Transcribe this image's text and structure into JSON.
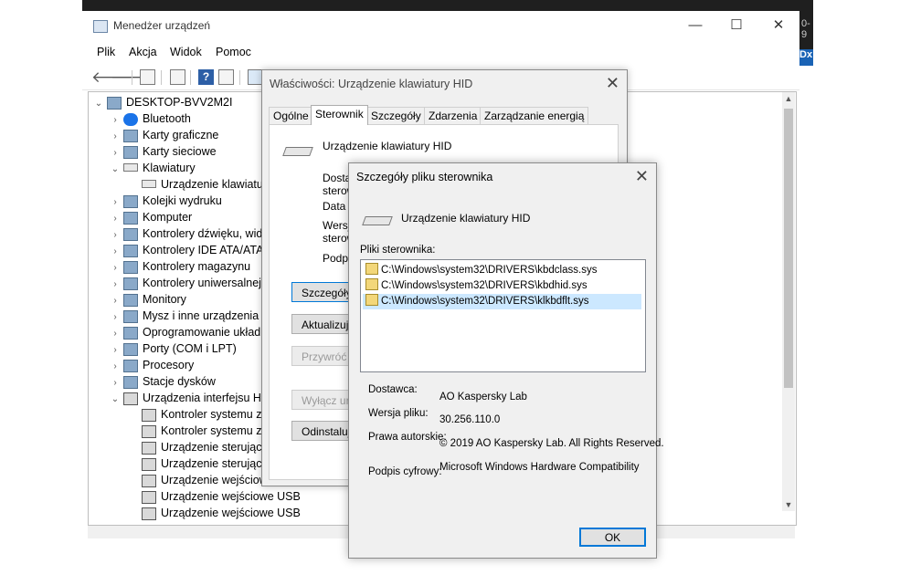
{
  "background_strip": {
    "text_top": "0-9",
    "text_badge": "Dx"
  },
  "device_manager": {
    "title": "Menedżer urządzeń",
    "caption": {
      "minimize": "—",
      "maximize": "☐",
      "close": "✕"
    },
    "menu": [
      "Plik",
      "Akcja",
      "Widok",
      "Pomoc"
    ],
    "tree": [
      {
        "label": "DESKTOP-BVV2M2I",
        "expander": "⌄",
        "icon": "computer-icon",
        "level": 0
      },
      {
        "label": "Bluetooth",
        "expander": "›",
        "icon": "bluetooth-icon",
        "level": 1
      },
      {
        "label": "Karty graficzne",
        "expander": "›",
        "icon": "display-adapter-icon",
        "level": 1
      },
      {
        "label": "Karty sieciowe",
        "expander": "›",
        "icon": "network-adapter-icon",
        "level": 1
      },
      {
        "label": "Klawiatury",
        "expander": "⌄",
        "icon": "keyboard-icon",
        "level": 1
      },
      {
        "label": "Urządzenie klawiatur",
        "expander": "",
        "icon": "keyboard-icon",
        "level": 2
      },
      {
        "label": "Kolejki wydruku",
        "expander": "›",
        "icon": "printer-icon",
        "level": 1
      },
      {
        "label": "Komputer",
        "expander": "›",
        "icon": "monitor-icon",
        "level": 1
      },
      {
        "label": "Kontrolery dźwięku, wid",
        "expander": "›",
        "icon": "speaker-icon",
        "level": 1
      },
      {
        "label": "Kontrolery IDE ATA/ATAP",
        "expander": "›",
        "icon": "ide-controller-icon",
        "level": 1
      },
      {
        "label": "Kontrolery magazynu",
        "expander": "›",
        "icon": "storage-controller-icon",
        "level": 1
      },
      {
        "label": "Kontrolery uniwersalnej",
        "expander": "›",
        "icon": "usb-icon",
        "level": 1
      },
      {
        "label": "Monitory",
        "expander": "›",
        "icon": "monitor-icon",
        "level": 1
      },
      {
        "label": "Mysz i inne urządzenia w",
        "expander": "›",
        "icon": "mouse-icon",
        "level": 1
      },
      {
        "label": "Oprogramowanie układ",
        "expander": "›",
        "icon": "chip-icon",
        "level": 1
      },
      {
        "label": "Porty (COM i LPT)",
        "expander": "›",
        "icon": "port-icon",
        "level": 1
      },
      {
        "label": "Procesory",
        "expander": "›",
        "icon": "processor-icon",
        "level": 1
      },
      {
        "label": "Stacje dysków",
        "expander": "›",
        "icon": "disk-drive-icon",
        "level": 1
      },
      {
        "label": "Urządzenia interfejsu HI",
        "expander": "⌄",
        "icon": "hid-icon",
        "level": 1
      },
      {
        "label": "Kontroler systemu zg",
        "expander": "",
        "icon": "hid-icon",
        "level": 2
      },
      {
        "label": "Kontroler systemu zg",
        "expander": "",
        "icon": "hid-icon",
        "level": 2
      },
      {
        "label": "Urządzenie sterując",
        "expander": "",
        "icon": "hid-icon",
        "level": 2
      },
      {
        "label": "Urządzenie sterując",
        "expander": "",
        "icon": "hid-icon",
        "level": 2
      },
      {
        "label": "Urządzenie wejściow",
        "expander": "",
        "icon": "hid-icon",
        "level": 2
      },
      {
        "label": "Urządzenie wejściowe USB",
        "expander": "",
        "icon": "hid-icon",
        "level": 2
      },
      {
        "label": "Urządzenie wejściowe USB",
        "expander": "",
        "icon": "hid-icon",
        "level": 2
      }
    ]
  },
  "properties_dialog": {
    "title": "Właściwości: Urządzenie klawiatury HID",
    "close": "✕",
    "tabs": [
      "Ogólne",
      "Sterownik",
      "Szczegóły",
      "Zdarzenia",
      "Zarządzanie energią"
    ],
    "active_tab": "Sterownik",
    "device_name": "Urządzenie klawiatury HID",
    "info_labels": [
      "Dostaw",
      "sterow",
      "Data s",
      "Wersja",
      "sterow",
      "Podpis"
    ],
    "buttons": [
      {
        "label": "Szczegóły ste",
        "disabled": false,
        "focused": true
      },
      {
        "label": "Aktualizuj st",
        "disabled": false,
        "focused": false
      },
      {
        "label": "Przywróć st",
        "disabled": true,
        "focused": false
      },
      {
        "label": "Wyłącz urz",
        "disabled": true,
        "focused": false
      },
      {
        "label": "Odinstaluj ur",
        "disabled": false,
        "focused": false
      }
    ]
  },
  "details_dialog": {
    "title": "Szczegóły pliku sterownika",
    "close": "✕",
    "device_name": "Urządzenie klawiatury HID",
    "files_label": "Pliki sterownika:",
    "files": [
      "C:\\Windows\\system32\\DRIVERS\\kbdclass.sys",
      "C:\\Windows\\system32\\DRIVERS\\kbdhid.sys",
      "C:\\Windows\\system32\\DRIVERS\\klkbdflt.sys"
    ],
    "selected_file_index": 2,
    "provider_label": "Dostawca:",
    "provider_value": "AO Kaspersky Lab",
    "version_label": "Wersja pliku:",
    "version_value": "30.256.110.0",
    "copyright_label": "Prawa autorskie:",
    "copyright_value": "© 2019 AO Kaspersky Lab. All Rights Reserved.",
    "signer_label": "Podpis cyfrowy:",
    "signer_value": "Microsoft Windows Hardware Compatibility",
    "ok_label": "OK"
  }
}
